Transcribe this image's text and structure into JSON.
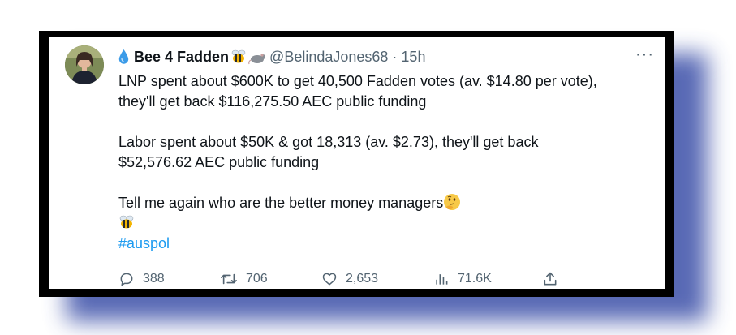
{
  "tweet": {
    "display_name": "Bee 4 Fadden",
    "handle": "@BelindaJones68",
    "separator": "·",
    "time": "15h",
    "more_label": "···",
    "paragraphs": [
      {
        "lines": [
          "LNP spent about $600K to get 40,500 Fadden votes (av. $14.80 per vote),",
          "they'll get back $116,275.50 AEC public funding"
        ]
      },
      {
        "lines": [
          "Labor spent about $50K & got 18,313 (av. $2.73), they'll get back",
          "$52,576.62 AEC public funding"
        ]
      },
      {
        "lines": [
          "Tell me again who are the better money managers"
        ]
      }
    ],
    "hashtag": "#auspol",
    "icons": {
      "name_prefix": "water-drop-icon",
      "name_suffix_1": "bee-icon",
      "name_suffix_2": "rat-icon",
      "thinking": "thinking-face-icon",
      "bee_line": "bee-icon"
    },
    "actions": {
      "replies": "388",
      "retweets": "706",
      "likes": "2,653",
      "views": "71.6K"
    },
    "colors": {
      "text": "#0f1419",
      "secondary": "#536471",
      "link": "#1d9bf0",
      "frame": "#000000",
      "shadow": "#3b4fa8"
    }
  }
}
